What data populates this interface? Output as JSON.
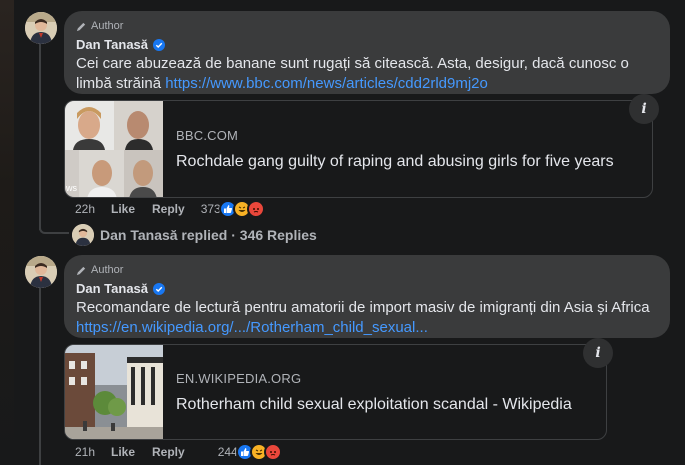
{
  "comments": [
    {
      "author_badge": "Author",
      "name": "Dan Tanasă",
      "text": "Cei care abuzează de banane sunt rugați să citească. Asta, desigur, dacă cunosc o limbă străină",
      "link": "https://www.bbc.com/news/articles/cdd2rld9mj2o",
      "card": {
        "domain": "BBC.COM",
        "title": "Rochdale gang guilty of raping and abusing girls for five years"
      },
      "time": "22h",
      "like": "Like",
      "reply": "Reply",
      "reaction_count": "373"
    },
    {
      "author_badge": "Author",
      "name": "Dan Tanasă",
      "text": "Recomandare de lectură pentru amatorii de import masiv de imigranți din Asia și Africa",
      "link": "https://en.wikipedia.org/.../Rotherham_child_sexual...",
      "card": {
        "domain": "EN.WIKIPEDIA.ORG",
        "title": "Rotherham child sexual exploitation scandal - Wikipedia"
      },
      "time": "21h",
      "like": "Like",
      "reply": "Reply",
      "reaction_count": "244"
    }
  ],
  "replied": {
    "text": "Dan Tanasă replied · 346 Replies"
  },
  "colors": {
    "background": "#18191a",
    "bubble": "#3a3b3c",
    "link": "#4599ff",
    "verified": "#1877f2",
    "like_reaction": "#1877f2",
    "angry_reaction": "#e9473b",
    "haha_reaction": "#f7b125"
  },
  "icons": [
    "pencil-icon",
    "verified-badge-icon",
    "info-icon",
    "like-reaction-icon",
    "haha-reaction-icon",
    "angry-reaction-icon"
  ]
}
